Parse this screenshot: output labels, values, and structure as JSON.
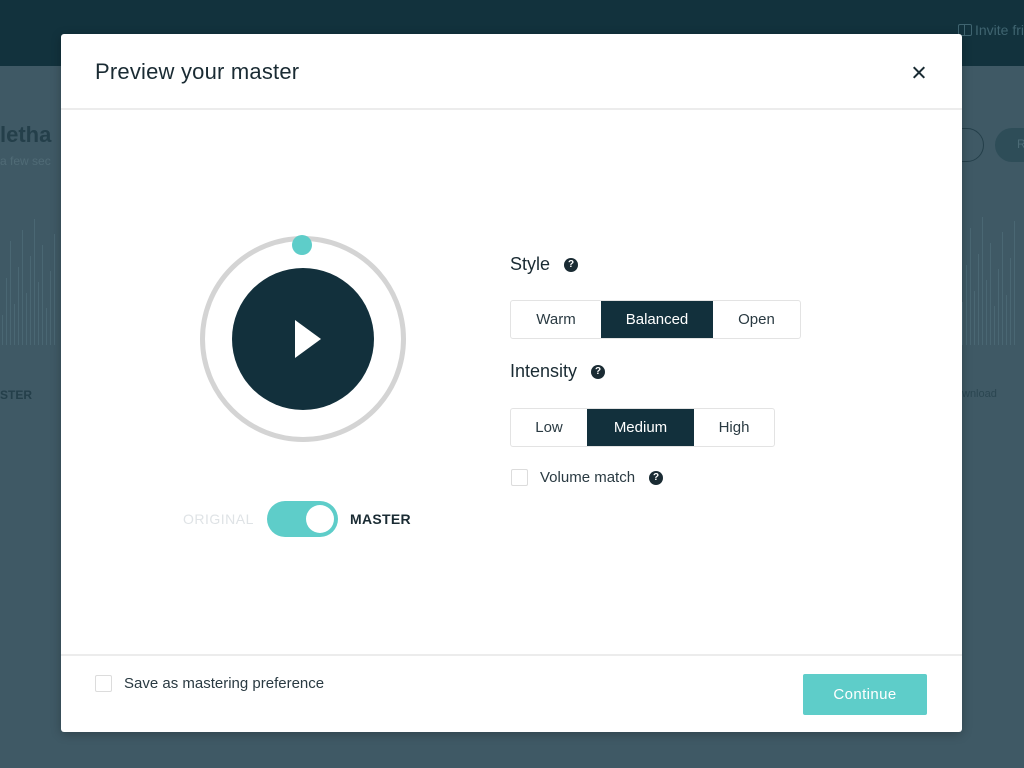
{
  "background": {
    "header": {
      "invite_label": "Invite fri"
    },
    "track_title": "letha",
    "track_subtitle": "a few sec",
    "master_label": "STER",
    "download_label": "wnload",
    "pill_button_label": "R"
  },
  "modal": {
    "title": "Preview your master",
    "close_icon": "close-icon",
    "player": {
      "play_icon": "play-icon",
      "progress": 0,
      "colors": {
        "accent": "#5ecdc9",
        "dark": "#12303c",
        "ring": "#d4d4d4"
      }
    },
    "toggle": {
      "left_label": "ORIGINAL",
      "right_label": "MASTER",
      "value": "MASTER"
    },
    "style": {
      "label": "Style",
      "help_icon": "?",
      "options": [
        "Warm",
        "Balanced",
        "Open"
      ],
      "selected": "Balanced"
    },
    "intensity": {
      "label": "Intensity",
      "help_icon": "?",
      "options": [
        "Low",
        "Medium",
        "High"
      ],
      "selected": "Medium"
    },
    "volume_match": {
      "label": "Volume match",
      "checked": false,
      "help_icon": "?"
    },
    "footer": {
      "save_preference_label": "Save as mastering preference",
      "save_preference_checked": false,
      "continue_label": "Continue"
    }
  }
}
